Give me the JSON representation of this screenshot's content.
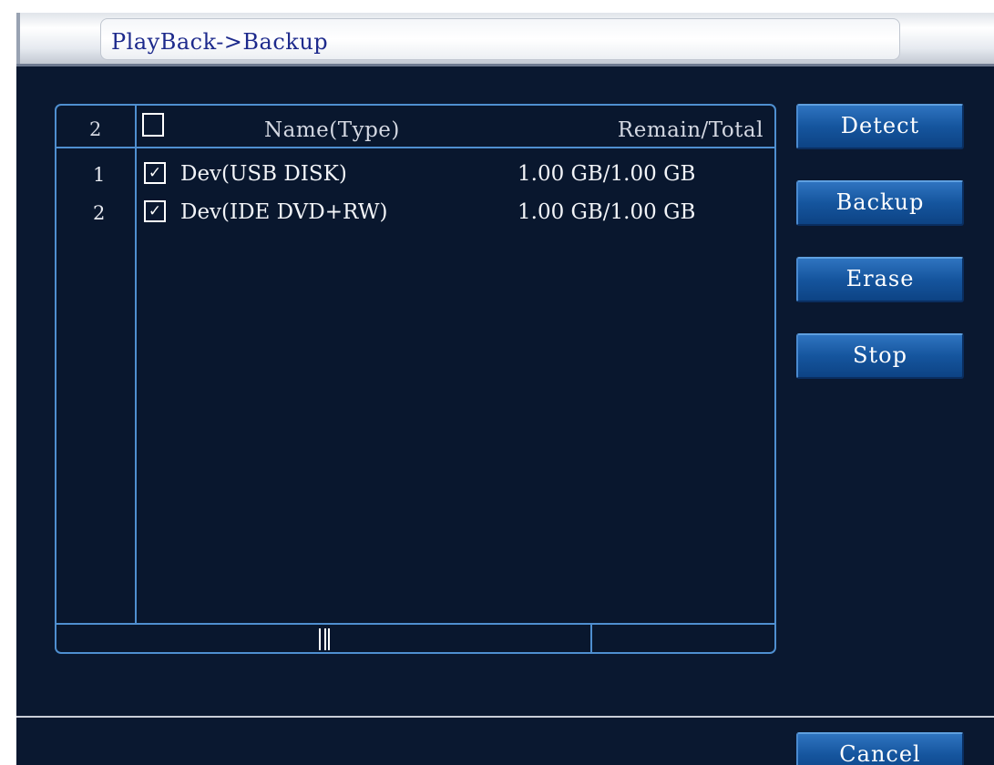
{
  "title": "PlayBack->Backup",
  "table": {
    "header": {
      "count": "2",
      "name": "Name(Type)",
      "remain_total": "Remain/Total",
      "select_all_checked": false
    },
    "rows": [
      {
        "index": "1",
        "checked": true,
        "check_glyph": "✓",
        "name": "Dev(USB DISK)",
        "remain_total": "1.00 GB/1.00 GB"
      },
      {
        "index": "2",
        "checked": true,
        "check_glyph": "✓",
        "name": "Dev(IDE DVD+RW)",
        "remain_total": "1.00 GB/1.00 GB"
      }
    ]
  },
  "buttons": {
    "detect": "Detect",
    "backup": "Backup",
    "erase": "Erase",
    "stop": "Stop",
    "cancel": "Cancel"
  },
  "colors": {
    "background": "#0a1830",
    "border_accent": "#4f8fd0",
    "button": "#15559e",
    "title_text": "#1d2a8c"
  }
}
